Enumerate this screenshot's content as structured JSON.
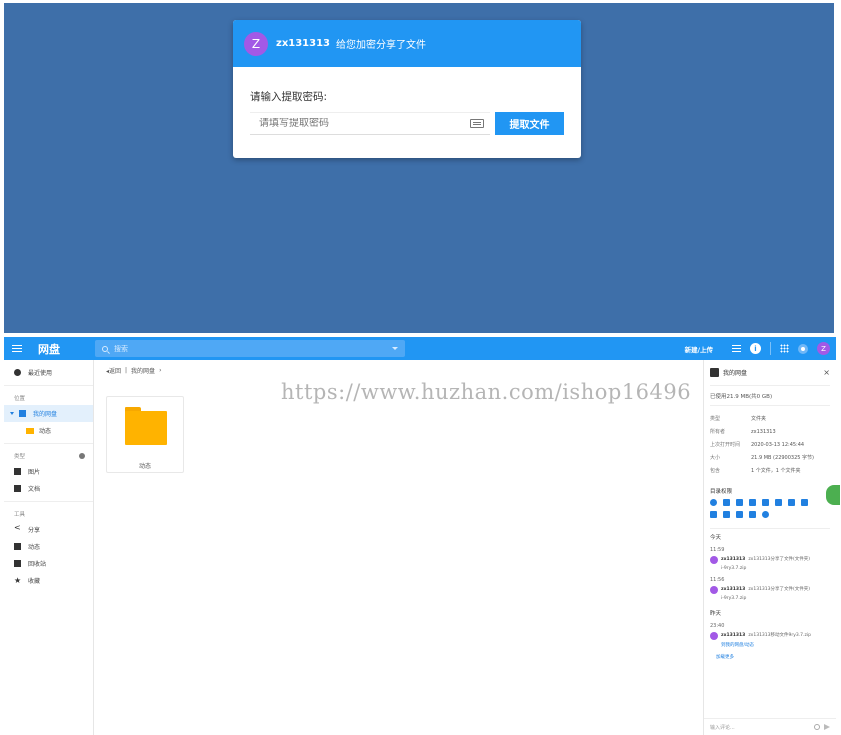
{
  "dialog": {
    "avatar_letter": "Z",
    "username": "zx131313",
    "message": "给您加密分享了文件",
    "prompt_label": "请输入提取密码:",
    "password_placeholder": "请填写提取密码",
    "submit_label": "提取文件"
  },
  "appbar": {
    "title": "网盘",
    "search_placeholder": "搜索",
    "new_upload_label": "新建/上传",
    "avatar_letter": "Z"
  },
  "sidebar": {
    "recent_label": "最近使用",
    "location_header": "位置",
    "my_drive_label": "我的网盘",
    "subfolder_label": "动态",
    "category_header": "类型",
    "images_label": "图片",
    "documents_label": "文档",
    "tools_header": "工具",
    "share_label": "分享",
    "activity_label": "动态",
    "recycle_label": "回收站",
    "favorites_label": "收藏"
  },
  "main": {
    "breadcrumb_back": "◂返回",
    "breadcrumb_sep": "|",
    "breadcrumb_current": "我的网盘",
    "breadcrumb_arrow": "›",
    "folder_name": "动态",
    "watermark": "https://www.huzhan.com/ishop16496"
  },
  "details": {
    "title": "我的网盘",
    "close": "×",
    "usage": "已使用21.9 MB(共0 GB)",
    "props": [
      {
        "k": "类型",
        "v": "文件夹"
      },
      {
        "k": "所有者",
        "v": "zx131313"
      },
      {
        "k": "上次打开时间",
        "v": "2020-03-13 12:45:44"
      },
      {
        "k": "大小",
        "v": "21.9 MB (22900325 字节)"
      },
      {
        "k": "包含",
        "v": "1 个文件，1 个文件夹"
      }
    ],
    "permissions_title": "目录权限",
    "today_label": "今天",
    "yesterday_label": "昨天",
    "activities": [
      {
        "time": "11:59",
        "user": "zx131313",
        "text": "zx131313分享了文件(文件夹)",
        "file": "i-9ry3.7.zip"
      },
      {
        "time": "11:56",
        "user": "zx131313",
        "text": "zx131313分享了文件(文件夹)",
        "file": "i-9ry3.7.zip"
      },
      {
        "time": "23:40",
        "user": "zx131313",
        "text": "zx131313移动文件9ry3.7.zip",
        "file": "到我的网盘/动态"
      }
    ],
    "more_label": "加载更多",
    "comment_placeholder": "输入评论..."
  },
  "colors": {
    "primary": "#2196f3",
    "top_background": "#3e6fa9",
    "avatar": "#a259e6",
    "folder": "#ffb300"
  }
}
